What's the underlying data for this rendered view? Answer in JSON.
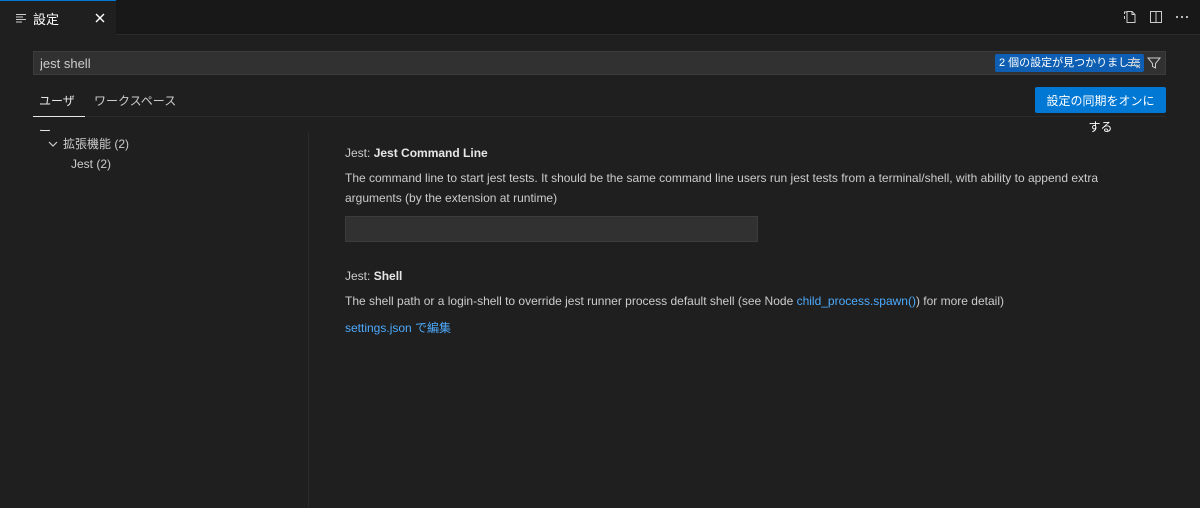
{
  "editor": {
    "tab_label": "設定",
    "tab_icon": "settings-list-icon",
    "close_icon": "close-icon",
    "actions": [
      "open-settings-json-icon",
      "split-editor-icon",
      "more-actions-icon"
    ]
  },
  "search": {
    "value": "jest shell",
    "result_badge": "2 個の設定が見つかりました",
    "clear_icon": "clear-filter-icon",
    "filter_icon": "filter-icon"
  },
  "scope_tabs": {
    "user": "ユーザー",
    "workspace": "ワークスペース"
  },
  "sync_button": "設定の同期をオンにする",
  "toc": {
    "group_label": "拡張機能 (2)",
    "child_label": "Jest (2)"
  },
  "settings": [
    {
      "category": "Jest: ",
      "name": "Jest Command Line",
      "description": "The command line to start jest tests. It should be the same command line users run jest tests from a terminal/shell, with ability to append extra arguments (by the extension at runtime)",
      "value": ""
    },
    {
      "category": "Jest: ",
      "name": "Shell",
      "description_before": "The shell path or a login-shell to override jest runner process default shell (see Node ",
      "description_link": "child_process.spawn()",
      "description_after": ") for more detail)",
      "edit_link": "settings.json で編集"
    }
  ],
  "colors": {
    "background": "#1f1f1f",
    "accent": "#0078d4",
    "badge": "#0e5fb3",
    "link": "#4daafc"
  }
}
